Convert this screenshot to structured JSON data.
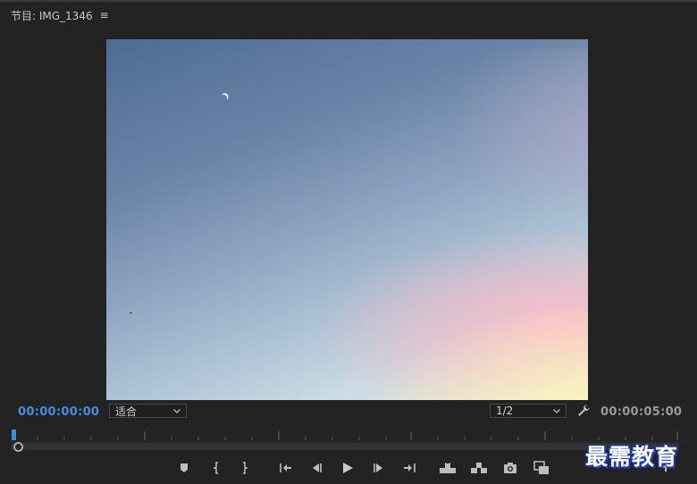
{
  "panel": {
    "title": "节目: IMG_1346",
    "menu_icon": "hamburger-menu-icon"
  },
  "monitor": {
    "content": "sky-video-frame"
  },
  "timecode": {
    "current": "00:00:00:00",
    "duration": "00:00:05:00"
  },
  "zoom": {
    "selected": "适合"
  },
  "resolution": {
    "selected": "1/2"
  },
  "playback": {
    "position_fraction": 0.0
  },
  "controls": [
    "add-marker-icon",
    "mark-in-icon",
    "mark-out-icon",
    "go-to-in-icon",
    "step-back-icon",
    "play-icon",
    "step-forward-icon",
    "go-to-out-icon",
    "lift-icon",
    "extract-icon",
    "export-frame-icon",
    "compare-view-icon",
    "button-editor-plus-icon"
  ],
  "colors": {
    "timecode_current": "#3d8fe6",
    "background": "#232323",
    "playhead": "#3d8fe6"
  },
  "watermark": {
    "text": "最需教育"
  }
}
